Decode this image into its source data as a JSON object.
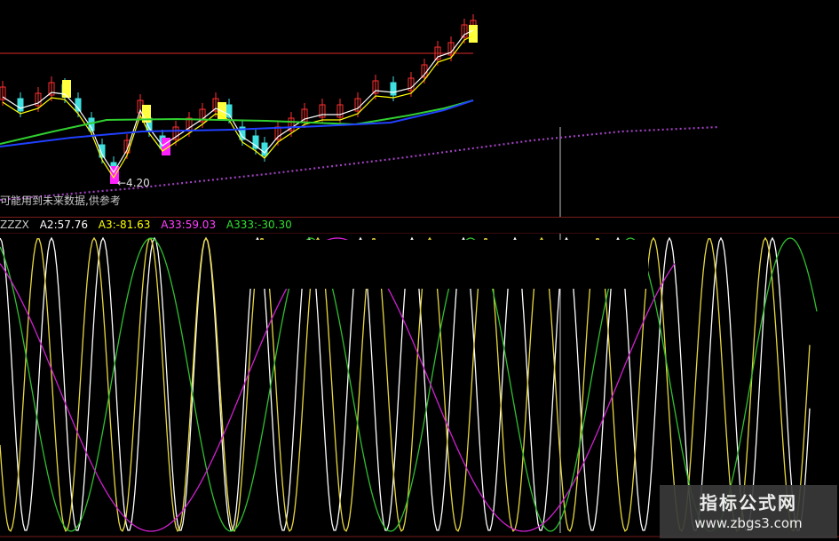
{
  "main_panel": {
    "note": "可能用到未来数据,供参考",
    "price_marker": "←4.20",
    "colors": {
      "up": "#ff3030",
      "down": "#40e0e0",
      "ma_white": "#ffffff",
      "ma_yellow": "#ffff00",
      "ma_green": "#30d030",
      "ma_blue": "#2040ff",
      "ma_purple": "#a040c0",
      "signal_yellow": "#ffff40",
      "signal_magenta": "#ff20ff",
      "resistance": "#b02020"
    }
  },
  "indicator_panel": {
    "legend": [
      {
        "label": "ZZZX",
        "color": "#c8c8c8"
      },
      {
        "label": "A2:57.76",
        "color": "#ffffff"
      },
      {
        "label": "A3:-81.63",
        "color": "#ffff00"
      },
      {
        "label": "A33:59.03",
        "color": "#ff40ff"
      },
      {
        "label": "A333:-30.30",
        "color": "#30e030"
      }
    ],
    "series_colors": {
      "white": "#ffffff",
      "yellow": "#e8d840",
      "green": "#30c030",
      "magenta": "#d020d0"
    }
  },
  "watermark": {
    "title": "指标公式网",
    "url": "www.zbgs3.com"
  }
}
